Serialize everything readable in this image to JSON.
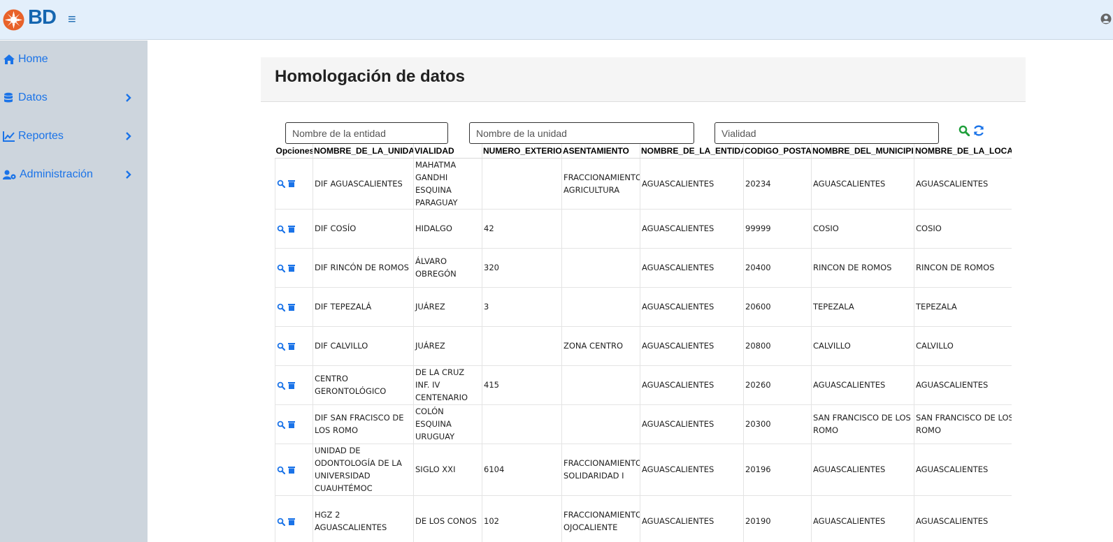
{
  "header": {
    "brand": "BD",
    "menu_icon": "hamburger-icon",
    "user_icon": "user-circle-icon"
  },
  "sidebar": {
    "items": [
      {
        "label": "Home",
        "icon": "home-icon",
        "has_submenu": false
      },
      {
        "label": "Datos",
        "icon": "database-icon",
        "has_submenu": true
      },
      {
        "label": "Reportes",
        "icon": "chart-line-icon",
        "has_submenu": true
      },
      {
        "label": "Administración",
        "icon": "users-cog-icon",
        "has_submenu": true
      }
    ]
  },
  "page": {
    "title": "Homologación de datos"
  },
  "filters": {
    "entity_placeholder": "Nombre de la entidad",
    "unit_placeholder": "Nombre de la unidad",
    "road_placeholder": "Vialidad",
    "search_icon": "search-icon",
    "refresh_icon": "refresh-icon"
  },
  "colors": {
    "accent": "#1a73e8",
    "brand": "#1566b0",
    "logo_orange": "#e8622a",
    "search_green": "#1e9e3a"
  },
  "table": {
    "columns": [
      "Opciones",
      "NOMBRE_DE_LA_UNIDAD",
      "VIALIDAD",
      "NUMERO_EXTERIOR",
      "ASENTAMIENTO",
      "NOMBRE_DE_LA_ENTIDAD",
      "CODIGO_POSTAL",
      "NOMBRE_DEL_MUNICIPIO",
      "NOMBRE_DE_LA_LOCALIDAD"
    ],
    "rows": [
      [
        "DIF AGUASCALIENTES",
        "MAHATMA GANDHI ESQUINA PARAGUAY",
        "",
        "FRACCIONAMIENTO AGRICULTURA",
        "AGUASCALIENTES",
        "20234",
        "AGUASCALIENTES",
        "AGUASCALIENTES"
      ],
      [
        "DIF COSÍO",
        "HIDALGO",
        "42",
        "",
        "AGUASCALIENTES",
        "99999",
        "COSIO",
        "COSIO"
      ],
      [
        "DIF RINCÓN DE ROMOS",
        "ÁLVARO OBREGÓN",
        "320",
        "",
        "AGUASCALIENTES",
        "20400",
        "RINCON DE ROMOS",
        "RINCON DE ROMOS"
      ],
      [
        "DIF TEPEZALÁ",
        "JUÁREZ",
        "3",
        "",
        "AGUASCALIENTES",
        "20600",
        "TEPEZALA",
        "TEPEZALA"
      ],
      [
        "DIF CALVILLO",
        "JUÁREZ",
        "",
        "ZONA CENTRO",
        "AGUASCALIENTES",
        "20800",
        "CALVILLO",
        "CALVILLO"
      ],
      [
        "CENTRO GERONTOLÓGICO",
        "DE LA CRUZ INF. IV CENTENARIO",
        "415",
        "",
        "AGUASCALIENTES",
        "20260",
        "AGUASCALIENTES",
        "AGUASCALIENTES"
      ],
      [
        "DIF SAN FRACISCO DE LOS ROMO",
        "COLÓN ESQUINA URUGUAY",
        "",
        "",
        "AGUASCALIENTES",
        "20300",
        "SAN FRANCISCO DE LOS ROMO",
        "SAN FRANCISCO DE LOS ROMO"
      ],
      [
        "UNIDAD DE ODONTOLOGÍA DE LA UNIVERSIDAD CUAUHTÉMOC",
        "SIGLO XXI",
        "6104",
        "FRACCIONAMIENTO SOLIDARIDAD I",
        "AGUASCALIENTES",
        "20196",
        "AGUASCALIENTES",
        "AGUASCALIENTES"
      ],
      [
        "HGZ 2 AGUASCALIENTES",
        "DE LOS CONOS",
        "102",
        "FRACCIONAMIENTO OJOCALIENTE",
        "AGUASCALIENTES",
        "20190",
        "AGUASCALIENTES",
        "AGUASCALIENTES"
      ]
    ],
    "row_actions": [
      "view-icon",
      "delete-icon"
    ]
  }
}
